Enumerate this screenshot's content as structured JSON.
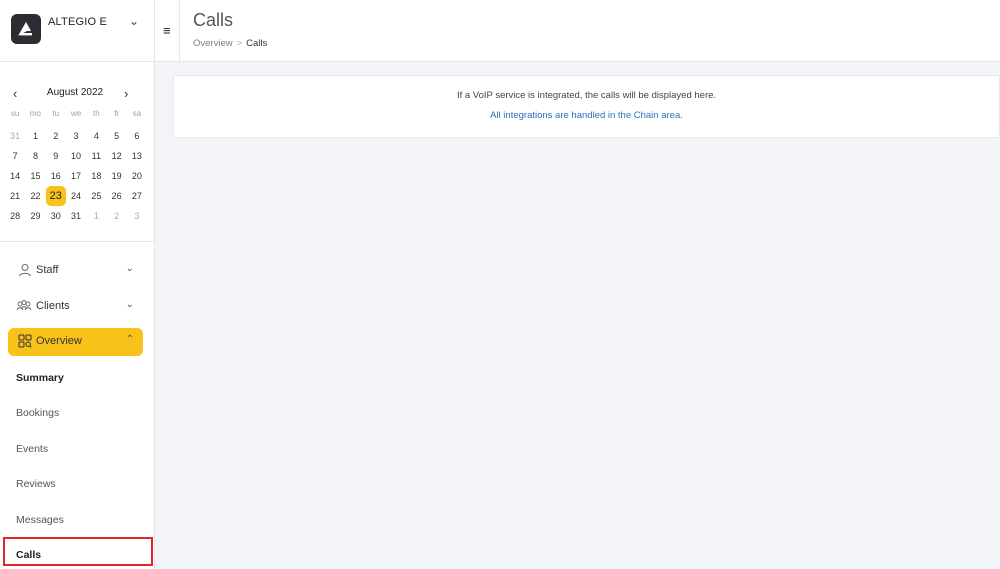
{
  "company": {
    "name": "ALTEGIO E"
  },
  "calendar": {
    "month_label": "August 2022",
    "weekdays": [
      "su",
      "mo",
      "tu",
      "we",
      "th",
      "fr",
      "sa"
    ],
    "weeks": [
      [
        "31",
        "1",
        "2",
        "3",
        "4",
        "5",
        "6"
      ],
      [
        "7",
        "8",
        "9",
        "10",
        "11",
        "12",
        "13"
      ],
      [
        "14",
        "15",
        "16",
        "17",
        "18",
        "19",
        "20"
      ],
      [
        "21",
        "22",
        "23",
        "24",
        "25",
        "26",
        "27"
      ],
      [
        "28",
        "29",
        "30",
        "31",
        "1",
        "2",
        "3"
      ]
    ],
    "today": "23"
  },
  "nav": {
    "staff": "Staff",
    "clients": "Clients",
    "overview": "Overview",
    "sub_items": [
      "Summary",
      "Bookings",
      "Events",
      "Reviews",
      "Messages",
      "Calls"
    ]
  },
  "header": {
    "title": "Calls",
    "breadcrumb": {
      "parent": "Overview",
      "separator": ">",
      "current": "Calls"
    }
  },
  "content": {
    "message": "If a VoIP service is integrated, the calls will be displayed here.",
    "link_text": "All integrations are handled in the Chain area."
  },
  "colors": {
    "accent": "#f8c21b",
    "link": "#2f6fb8",
    "highlight": "#e0262b"
  }
}
